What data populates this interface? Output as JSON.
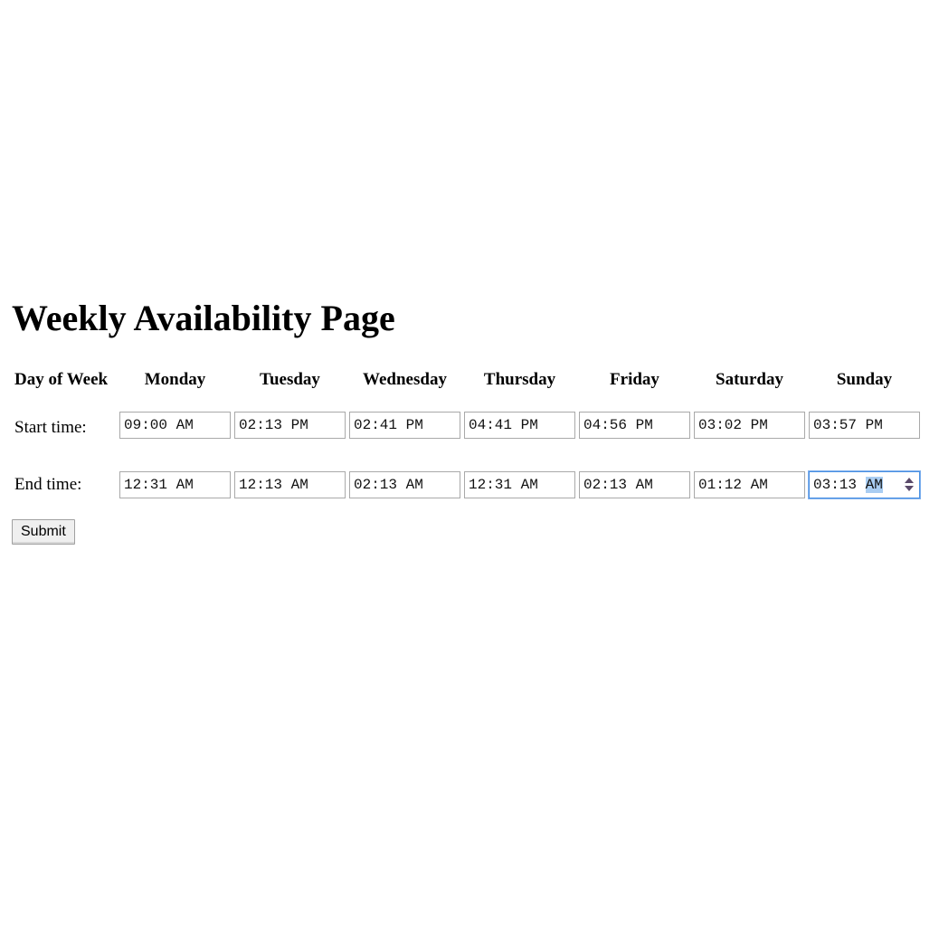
{
  "page": {
    "title": "Weekly Availability Page"
  },
  "table": {
    "header_label": "Day of Week",
    "days": [
      "Monday",
      "Tuesday",
      "Wednesday",
      "Thursday",
      "Friday",
      "Saturday",
      "Sunday"
    ],
    "start_label": "Start time:",
    "end_label": "End time:",
    "start_times": [
      "09:00 AM",
      "02:13 PM",
      "02:41 PM",
      "04:41 PM",
      "04:56 PM",
      "03:02 PM",
      "03:57 PM"
    ],
    "end_times": [
      "12:31 AM",
      "12:13 AM",
      "02:13 AM",
      "12:31 AM",
      "02:13 AM",
      "01:12 AM",
      "03:13 AM"
    ],
    "focused_end_field": {
      "time_part": "03:13",
      "ampm_part": "AM"
    }
  },
  "form": {
    "submit_label": "Submit"
  },
  "colors": {
    "focus_border": "#4a90e2",
    "selection_highlight": "#a9cdf2"
  }
}
